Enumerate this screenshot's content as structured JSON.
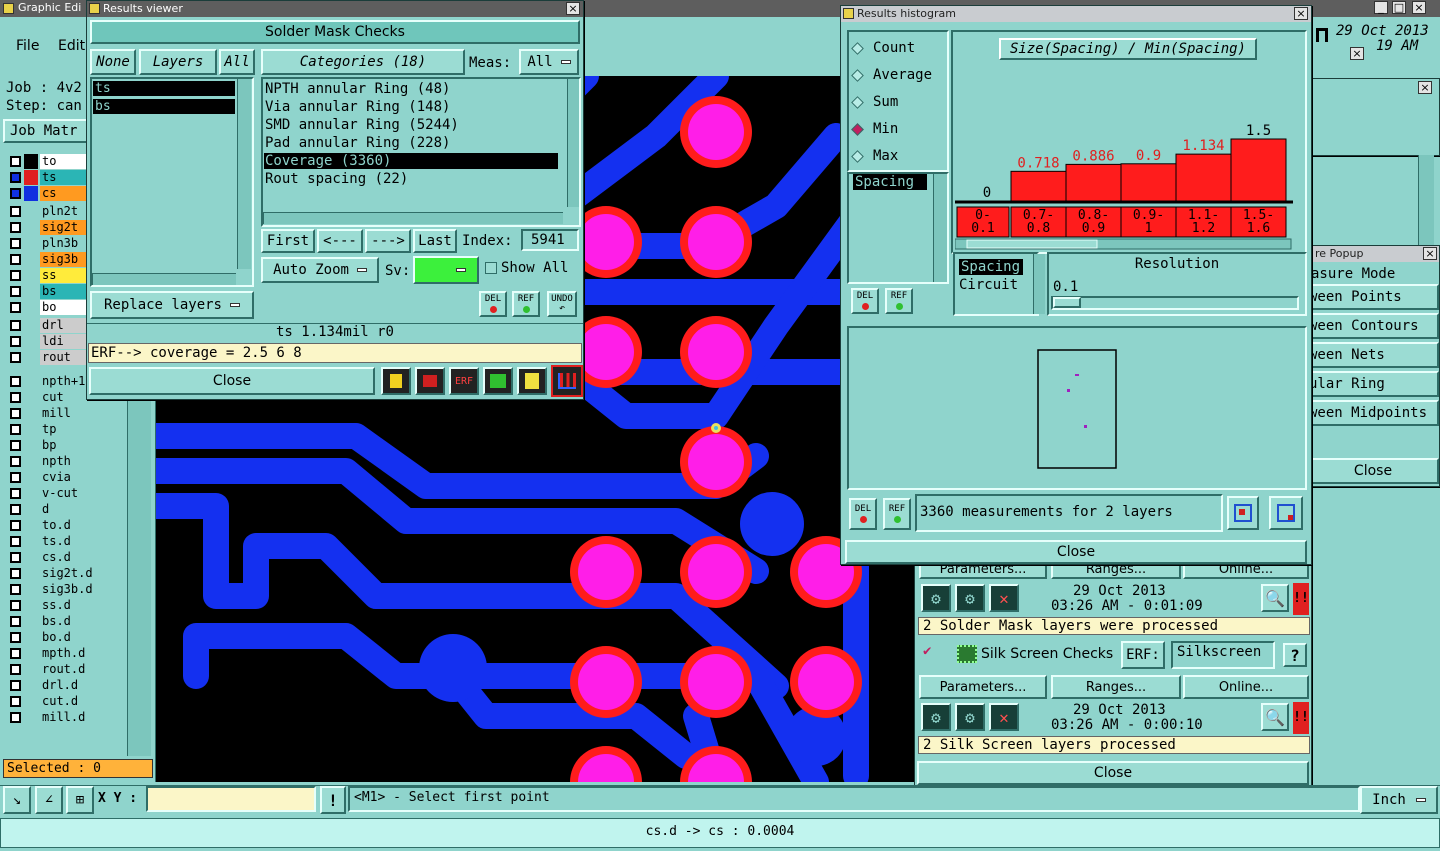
{
  "main": {
    "app_title": "Graphic Edi",
    "menu": [
      "File",
      "Edit"
    ],
    "job_label": "Job : 4v2",
    "step_label": "Step: can",
    "job_matrix_button": "Job Matr",
    "datetime": {
      "date": "29 Oct 2013",
      "time": "19 AM"
    },
    "layers": [
      {
        "name": "to",
        "color": "#ffffff",
        "mark": "#000000"
      },
      {
        "name": "ts",
        "color": "#2bb5b5",
        "mark": "#e02020",
        "sel": true
      },
      {
        "name": "cs",
        "color": "#ff9a20",
        "mark": "#1030e0",
        "sel": true
      },
      {
        "name": "pln2t",
        "color": "#8fd4cc",
        "mark": ""
      },
      {
        "name": "sig2t",
        "color": "#ff9a20",
        "mark": ""
      },
      {
        "name": "pln3b",
        "color": "#8fd4cc",
        "mark": ""
      },
      {
        "name": "sig3b",
        "color": "#ff9a20",
        "mark": ""
      },
      {
        "name": "ss",
        "color": "#ffeb3b",
        "mark": ""
      },
      {
        "name": "bs",
        "color": "#2bb5b5",
        "mark": ""
      },
      {
        "name": "bo",
        "color": "#ffffff",
        "mark": ""
      },
      {
        "name": "drl",
        "color": "#cccccc",
        "mark": ""
      },
      {
        "name": "ldi",
        "color": "#cccccc",
        "mark": ""
      },
      {
        "name": "rout",
        "color": "#cccccc",
        "mark": ""
      },
      {
        "name": "npth+1",
        "color": "#8fd4cc",
        "mark": ""
      },
      {
        "name": "cut",
        "color": "#8fd4cc",
        "mark": ""
      },
      {
        "name": "mill",
        "color": "#8fd4cc",
        "mark": ""
      },
      {
        "name": "tp",
        "color": "#8fd4cc",
        "mark": ""
      },
      {
        "name": "bp",
        "color": "#8fd4cc",
        "mark": ""
      },
      {
        "name": "npth",
        "color": "#8fd4cc",
        "mark": ""
      },
      {
        "name": "cvia",
        "color": "#8fd4cc",
        "mark": ""
      },
      {
        "name": "v-cut",
        "color": "#8fd4cc",
        "mark": ""
      },
      {
        "name": "d",
        "color": "#8fd4cc",
        "mark": ""
      },
      {
        "name": "to.d",
        "color": "#8fd4cc",
        "mark": ""
      },
      {
        "name": "ts.d",
        "color": "#8fd4cc",
        "mark": ""
      },
      {
        "name": "cs.d",
        "color": "#8fd4cc",
        "mark": ""
      },
      {
        "name": "sig2t.d",
        "color": "#8fd4cc",
        "mark": ""
      },
      {
        "name": "sig3b.d",
        "color": "#8fd4cc",
        "mark": ""
      },
      {
        "name": "ss.d",
        "color": "#8fd4cc",
        "mark": ""
      },
      {
        "name": "bs.d",
        "color": "#8fd4cc",
        "mark": ""
      },
      {
        "name": "bo.d",
        "color": "#8fd4cc",
        "mark": ""
      },
      {
        "name": "mpth.d",
        "color": "#8fd4cc",
        "mark": ""
      },
      {
        "name": "rout.d",
        "color": "#8fd4cc",
        "mark": ""
      },
      {
        "name": "drl.d",
        "color": "#8fd4cc",
        "mark": ""
      },
      {
        "name": "cut.d",
        "color": "#8fd4cc",
        "mark": ""
      },
      {
        "name": "mill.d",
        "color": "#8fd4cc",
        "mark": ""
      }
    ],
    "selected_label": "Selected : 0",
    "xy_label": "X Y :",
    "xy_value": "",
    "prompt": "<M1> - Select first point",
    "units": "Inch",
    "status": "cs.d -> cs : 0.0004"
  },
  "results_viewer": {
    "title": "Results viewer",
    "header": "Solder Mask Checks",
    "none_btn": "None",
    "layers_btn": "Layers",
    "all_btn": "All",
    "layers": [
      "ts",
      "bs"
    ],
    "categories_btn": "Categories (18)",
    "meas_label": "Meas:",
    "meas_value": "All",
    "categories": [
      "NPTH annular Ring (48)",
      "Via annular Ring (148)",
      "SMD annular Ring (5244)",
      "Pad annular Ring (228)",
      "Coverage (3360)",
      "Rout spacing (22)"
    ],
    "selected_category": 4,
    "first_btn": "First",
    "prev_btn": "<---",
    "next_btn": "--->",
    "last_btn": "Last",
    "index_label": "Index:",
    "index_value": "5941",
    "replace_btn": "Replace layers",
    "auto_zoom_btn": "Auto Zoom",
    "sv_label": "Sv:",
    "show_all_label": "Show All",
    "del_label": "DEL",
    "ref_label": "REF",
    "undo_label": "UNDO",
    "info": "ts 1.134mil  r0",
    "erf": "ERF--> coverage = 2.5 6 8",
    "close_btn": "Close"
  },
  "histogram": {
    "title": "Results histogram",
    "modes": [
      "Count",
      "Average",
      "Sum",
      "Min",
      "Max"
    ],
    "selected_mode": 3,
    "measures": [
      "Spacing"
    ],
    "chart_title": "Size(Spacing) / Min(Spacing)",
    "del_label": "DEL",
    "ref_label": "REF",
    "list2": [
      "Spacing",
      "Circuit"
    ],
    "resolution_label": "Resolution",
    "resolution_value": "0.1",
    "measurements_text": "3360 measurements for 2 layers",
    "close_btn": "Close",
    "chart_data": {
      "type": "bar",
      "categories": [
        "0-\n0.1",
        "0.7-\n0.8",
        "0.8-\n0.9",
        "0.9-\n1",
        "1.1-\n1.2",
        "1.5-\n1.6"
      ],
      "values": [
        0,
        0.718,
        0.886,
        0.9,
        1.134,
        1.5
      ],
      "labels": [
        "0",
        "0.718",
        "0.886",
        "0.9",
        "1.134",
        "1.5"
      ],
      "title": "Size(Spacing) / Min(Spacing)",
      "bar_color": "#ff1c1c"
    }
  },
  "measure_popup": {
    "title": "re Popup",
    "mode_label": "asure Mode",
    "options": [
      "ween Points",
      "ween Contours",
      "ween Nets",
      "ular Ring",
      "ween Midpoints"
    ],
    "close_btn": "Close"
  },
  "checks_panel": {
    "top_buttons": [
      "Parameters...",
      "Ranges...",
      "Online..."
    ],
    "solder": {
      "date": "29 Oct 2013",
      "time": "03:26 AM - 0:01:09",
      "message": "2 Solder Mask layers were processed"
    },
    "silk": {
      "name": "Silk Screen Checks",
      "erf_label": "ERF:",
      "erf_value": "Silkscreen",
      "help": "?",
      "buttons": [
        "Parameters...",
        "Ranges...",
        "Online..."
      ],
      "date": "29 Oct 2013",
      "time": "03:26 AM - 0:00:10",
      "message": "2 Silk Screen layers processed"
    },
    "close_btn": "Close"
  }
}
